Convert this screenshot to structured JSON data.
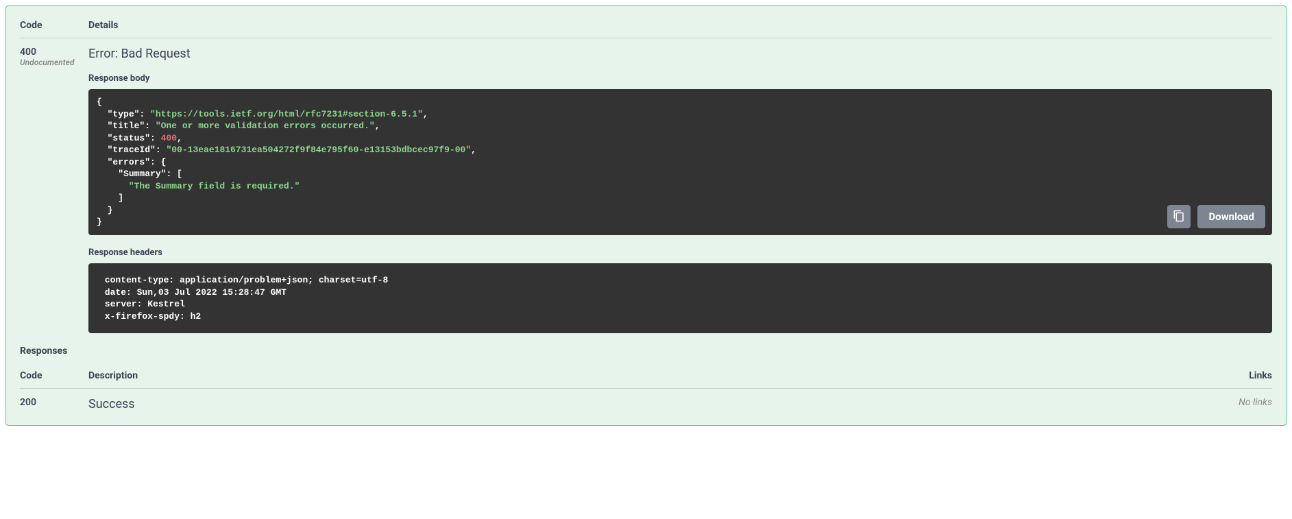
{
  "section1": {
    "header_code": "Code",
    "header_details": "Details",
    "code_value": "400",
    "undocumented_label": "Undocumented",
    "error_title": "Error: Bad Request",
    "response_body_label": "Response body",
    "response_headers_label": "Response headers",
    "download_label": "Download",
    "body_json": {
      "type_key": "\"type\"",
      "type_val": "\"https://tools.ietf.org/html/rfc7231#section-6.5.1\"",
      "title_key": "\"title\"",
      "title_val": "\"One or more validation errors occurred.\"",
      "status_key": "\"status\"",
      "status_val": "400",
      "traceId_key": "\"traceId\"",
      "traceId_val": "\"00-13eae1816731ea504272f9f84e795f60-e13153bdbcec97f9-00\"",
      "errors_key": "\"errors\"",
      "summary_key": "\"Summary\"",
      "summary_msg": "\"The Summary field is required.\""
    },
    "headers_text": " content-type: application/problem+json; charset=utf-8 \n date: Sun,03 Jul 2022 15:28:47 GMT \n server: Kestrel \n x-firefox-spdy: h2 "
  },
  "responses": {
    "heading": "Responses",
    "header_code": "Code",
    "header_description": "Description",
    "header_links": "Links",
    "rows": [
      {
        "code": "200",
        "description": "Success",
        "links": "No links"
      }
    ]
  }
}
